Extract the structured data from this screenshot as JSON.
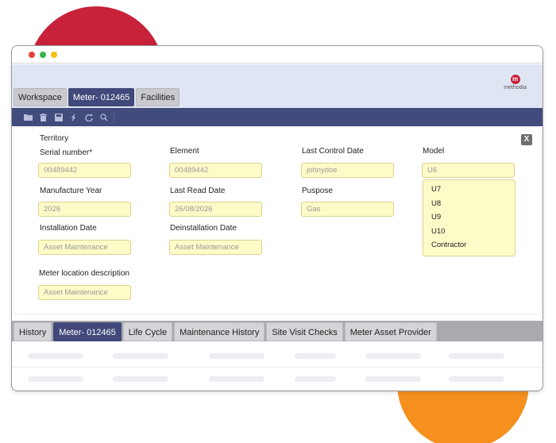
{
  "window": {
    "controls": [
      "close",
      "minimize",
      "maximize"
    ]
  },
  "logo": {
    "mark": "m",
    "text": "methodia"
  },
  "top_tabs": [
    {
      "label": "Workspace",
      "active": false
    },
    {
      "label": "Meter- 012465",
      "active": true
    },
    {
      "label": "Facilities",
      "active": false
    }
  ],
  "toolbar": {
    "icons": [
      "folder-icon",
      "trash-icon",
      "save-icon",
      "link-icon",
      "refresh-icon",
      "search-icon"
    ]
  },
  "form": {
    "close_label": "X",
    "territory_label": "Territory",
    "serial_number": {
      "label": "Serial number*",
      "value": "00489442"
    },
    "element": {
      "label": "Element",
      "value": "00489442"
    },
    "last_control_date": {
      "label": "Last Control Date",
      "value": "johnydoe"
    },
    "model": {
      "label": "Model",
      "value": "U6",
      "options": [
        "U7",
        "U8",
        "U9",
        "U10",
        "Contractor"
      ]
    },
    "manufacture_year": {
      "label": "Manufacture Year",
      "value": "2026"
    },
    "last_read_date": {
      "label": "Last Read Date",
      "value": "26/08/2026"
    },
    "purpose": {
      "label": "Puspose",
      "value": "Gas"
    },
    "installation_date": {
      "label": "Installation Date",
      "placeholder": "Asset Maintenance"
    },
    "deinstallation_date": {
      "label": "Deinstallation Date",
      "placeholder": "Asset Maintenance"
    },
    "meter_location_description": {
      "label": "Meter location description",
      "placeholder": "Asset Maintenance"
    }
  },
  "bottom_tabs": [
    {
      "label": "History",
      "active": false
    },
    {
      "label": "Meter- 012465",
      "active": true
    },
    {
      "label": "Life Cycle",
      "active": false
    },
    {
      "label": "Maintenance History",
      "active": false
    },
    {
      "label": "Site Visit Checks",
      "active": false
    },
    {
      "label": "Meter Asset Provider",
      "active": false
    }
  ],
  "colors": {
    "accent": "#41497a",
    "header_bg": "#dfe5f3",
    "field_bg": "#fdfbc8",
    "brand_red": "#c8213a",
    "brand_orange": "#f5901e"
  }
}
